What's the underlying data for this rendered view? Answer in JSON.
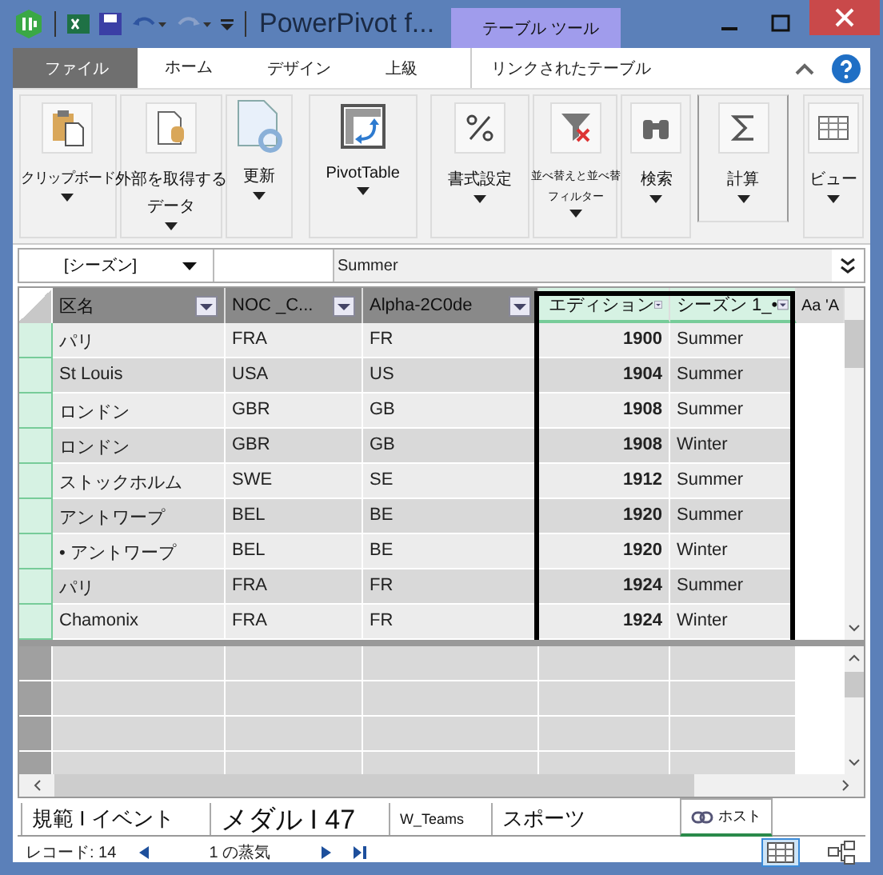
{
  "window": {
    "title": "PowerPivot f...",
    "context_tab": "テーブル ツール"
  },
  "ribbon_tabs": [
    {
      "label": "ファイル",
      "kind": "file",
      "selected": false
    },
    {
      "label": "ホーム",
      "kind": "tab",
      "selected": true
    },
    {
      "label": "デザイン",
      "kind": "tab",
      "selected": false
    },
    {
      "label": "上級",
      "kind": "tab",
      "selected": false
    },
    {
      "label": "リンクされたテーブル",
      "kind": "context",
      "selected": false
    }
  ],
  "ribbon_groups": [
    {
      "kind": "clipboard",
      "label": "クリップボード"
    },
    {
      "kind": "external",
      "label": "外部を取得する",
      "label_2": "データ"
    },
    {
      "kind": "refresh",
      "label": "更新"
    },
    {
      "kind": "pivot",
      "label": "PivotTable"
    },
    {
      "kind": "format",
      "label": "書式設定"
    },
    {
      "kind": "filter",
      "label": "並べ替えと並べ替",
      "label_2": "フィルター"
    },
    {
      "kind": "find",
      "label": "検索"
    },
    {
      "kind": "calc",
      "label": "計算"
    },
    {
      "kind": "view",
      "label": "ビュー"
    }
  ],
  "formula_bar": {
    "name": "[シーズン]",
    "value": "Summer"
  },
  "columns": [
    {
      "label": "区名",
      "selected": false
    },
    {
      "label": "NOC _C...",
      "selected": false
    },
    {
      "label": "Alpha-2C0de",
      "selected": false
    },
    {
      "label": "エディション",
      "selected": true
    },
    {
      "label": "シーズン 1_•",
      "selected": true
    },
    {
      "label": "Aa 'A",
      "selected": false
    }
  ],
  "rows": [
    [
      "パリ",
      "FRA",
      "FR",
      "1900",
      "Summer"
    ],
    [
      "St Louis",
      "USA",
      "US",
      "1904",
      "Summer"
    ],
    [
      "ロンドン",
      "GBR",
      "GB",
      "1908",
      "Summer"
    ],
    [
      "ロンドン",
      "GBR",
      "GB",
      "1908",
      "Winter"
    ],
    [
      "ストックホルム",
      "SWE",
      "SE",
      "1912",
      "Summer"
    ],
    [
      "アントワープ",
      "BEL",
      "BE",
      "1920",
      "Summer"
    ],
    [
      "• アントワープ",
      "BEL",
      "BE",
      "1920",
      "Winter"
    ],
    [
      "パリ",
      "FRA",
      "FR",
      "1924",
      "Summer"
    ],
    [
      "Chamonix",
      "FRA",
      "FR",
      "1924",
      "Winter"
    ]
  ],
  "sheet_tabs": [
    {
      "label": "規範 I イベント",
      "selected": false
    },
    {
      "label": "メダル I 47",
      "selected": false
    },
    {
      "label": "W_Teams",
      "selected": false
    },
    {
      "label": "スポーツ",
      "selected": false
    },
    {
      "label": "ホスト",
      "selected": true
    }
  ],
  "status": {
    "records": "レコード: 14",
    "position": "1 の蒸気"
  },
  "views": [
    {
      "kind": "grid",
      "selected": true
    },
    {
      "kind": "diagram",
      "selected": false
    }
  ]
}
